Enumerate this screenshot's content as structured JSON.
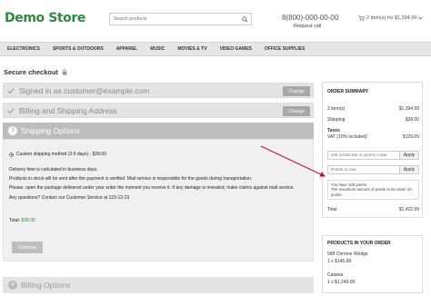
{
  "header": {
    "logo": "Demo Store",
    "search_placeholder": "Search products",
    "phone": "8(800)-000-00-00",
    "request_call": "Request call",
    "cart_text": "2 item(s) for $1,394.99"
  },
  "nav": {
    "items": [
      "ELECTRONICS",
      "SPORTS & OUTDOORS",
      "APPAREL",
      "MUSIC",
      "MOVIES & TV",
      "VIDEO GAMES",
      "OFFICE SUPPLIES"
    ]
  },
  "checkout": {
    "title": "Secure checkout",
    "step_signed": "Signed in as customer@example.com",
    "step_billing_shipping": "Billing and Shipping Address",
    "change_label": "Change",
    "step_shipping_num": "3",
    "step_shipping": "Shipping Options",
    "shipping_method": "Custom shipping method (3-5 days) - $28.00",
    "delivery_lines": [
      "Delivery time is calculated in business days.",
      "Products in stock will be sent after the payment is verified. Mail service is responsible for the goods during transportation.",
      "Please, open the package delivered under your order the moment you receive it. If any damage is revealed, make claims against mail service.",
      "Any questions? Contact our Customer Service at 123-12-23"
    ],
    "total_label": "Total:",
    "total_value": "$28.00",
    "continue_label": "Continue",
    "step_billing_num": "4",
    "step_billing": "Billing Options"
  },
  "order_summary": {
    "title": "ORDER SUMMARY",
    "items_label": "2 item(s)",
    "items_value": "$1,394.99",
    "shipping_label": "Shipping",
    "shipping_value": "$28.00",
    "taxes_label": "Taxes",
    "vat_label": "VAT (10% included)",
    "vat_value": "$129.09",
    "gift_placeholder": "Gift certificate or promo code",
    "apply_label": "Apply",
    "points_placeholder": "Points to use",
    "points_note_1": "You have 100 points.",
    "points_note_2": "The maximum amount of points to be used: 20 points.",
    "total_label": "Total",
    "total_value": "$1,422.99"
  },
  "products": {
    "title": "PRODUCTS IN YOUR ORDER",
    "items": [
      {
        "name": "588 Chrome Wedge",
        "qty_price": "1 x $145.99"
      },
      {
        "name": "Catania",
        "qty_price": "1 x $1,249.00"
      }
    ]
  },
  "colors": {
    "brand_green": "#2c8a3c",
    "annotation_arrow": "#c8102e"
  }
}
